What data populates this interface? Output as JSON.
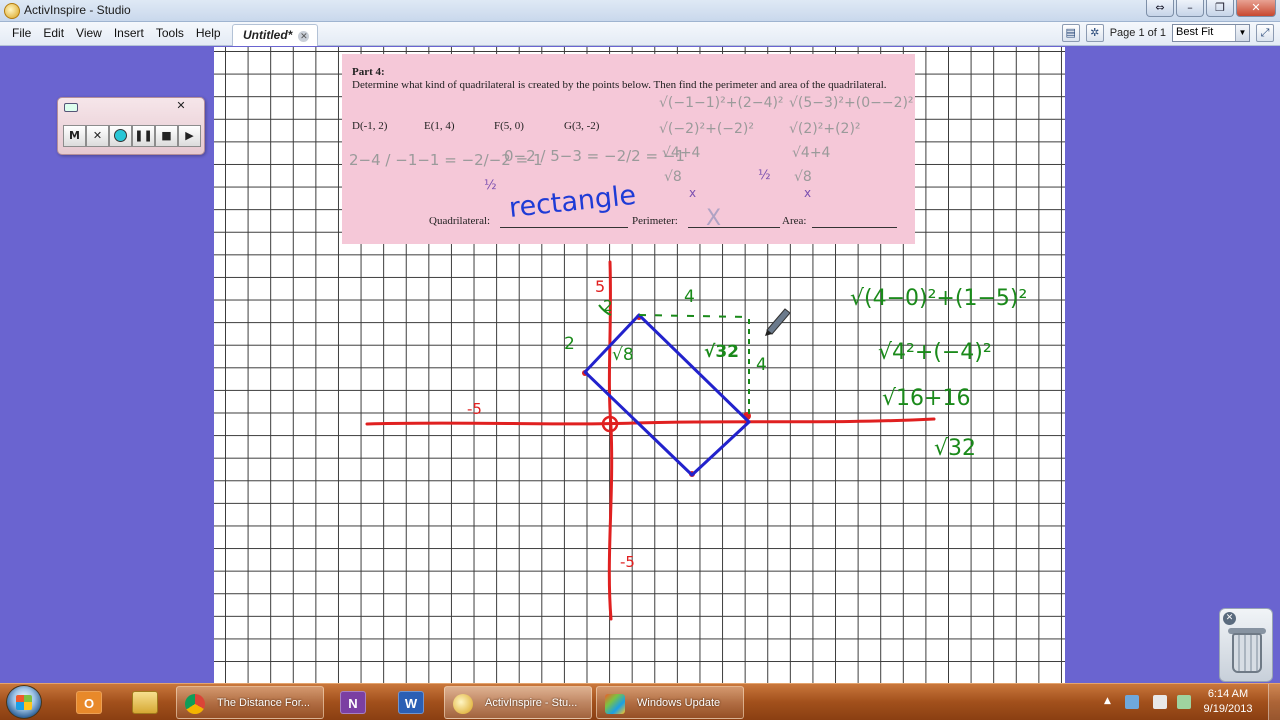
{
  "window": {
    "title": "ActivInspire - Studio"
  },
  "window_buttons": {
    "restore": "⇔",
    "minimize": "–",
    "maximize": "❐",
    "close": "✕"
  },
  "menu": [
    "File",
    "Edit",
    "View",
    "Insert",
    "Tools",
    "Help"
  ],
  "doc_tab": {
    "label": "Untitled*"
  },
  "toolbar": {
    "page_label": "Page 1 of 1",
    "zoom_value": "Best Fit"
  },
  "recorder": {
    "buttons": [
      "M",
      "✕",
      "",
      "❚❚",
      "■",
      "▶"
    ],
    "close": "✕"
  },
  "worksheet": {
    "part": "Part 4:",
    "instructions": "Determine what kind of quadrilateral is created by the points below.  Then find the perimeter and area of the quadrilateral.",
    "points": [
      "D(-1, 2)",
      "E(1, 4)",
      "F(5, 0)",
      "G(3, -2)"
    ],
    "quadrilateral_label": "Quadrilateral:",
    "perimeter_label": "Perimeter:",
    "area_label": "Area:"
  },
  "handwriting": {
    "answer": "rectangle",
    "perimeter_mark": "X",
    "half_1": "½",
    "half_2": "½",
    "x_mark": "x",
    "axis_5_top": "5",
    "axis_neg5_left": "-5",
    "axis_neg5_bottom": "-5",
    "run_label": "4",
    "rise_label": "4",
    "short_side_label": "2",
    "y_label": "2",
    "side_1": "√8",
    "side_2": "√32",
    "work_1": "√(4−0)²+(1−5)²",
    "work_2": "√4²+(−4)²",
    "work_3": "√16+16",
    "work_4": "√32",
    "ws_calc_1": "2−4 / −1−1 = −2/−2 = 1",
    "ws_calc_2": "0−2 / 5−3 = −2/2 = −1",
    "ws_calc_3": "√(−1−1)²+(2−4)²",
    "ws_calc_4": "√(−2)²+(−2)²",
    "ws_calc_5": "√4+4",
    "ws_calc_6": "√8",
    "ws_calc_7": "√(5−3)²+(0−−2)²",
    "ws_calc_8": "√(2)²+(2)²",
    "ws_calc_9": "√4+4",
    "ws_calc_10": "√8"
  },
  "colors": {
    "desktop_bg": "#6a64d0",
    "axis": "#e02020",
    "shape": "#2222cc",
    "work": "#1a8a1a",
    "worksheet_bg": "#f5c8d8",
    "taskbar": "#a2501c"
  },
  "taskbar": {
    "tasks": [
      {
        "label": "The Distance For...",
        "icon": "chrome-icon"
      },
      {
        "label": "ActivInspire - Stu...",
        "icon": "activinspire-icon"
      },
      {
        "label": "Windows Update",
        "icon": "windows-update-icon"
      }
    ],
    "pinned": [
      {
        "label": "O",
        "icon": "outlook-icon"
      },
      {
        "label": "",
        "icon": "folder-icon"
      },
      {
        "label": "N",
        "icon": "onenote-icon"
      },
      {
        "label": "W",
        "icon": "word-icon"
      }
    ],
    "clock": {
      "time": "6:14 AM",
      "date": "9/19/2013"
    },
    "tray_arrow": "▲"
  }
}
